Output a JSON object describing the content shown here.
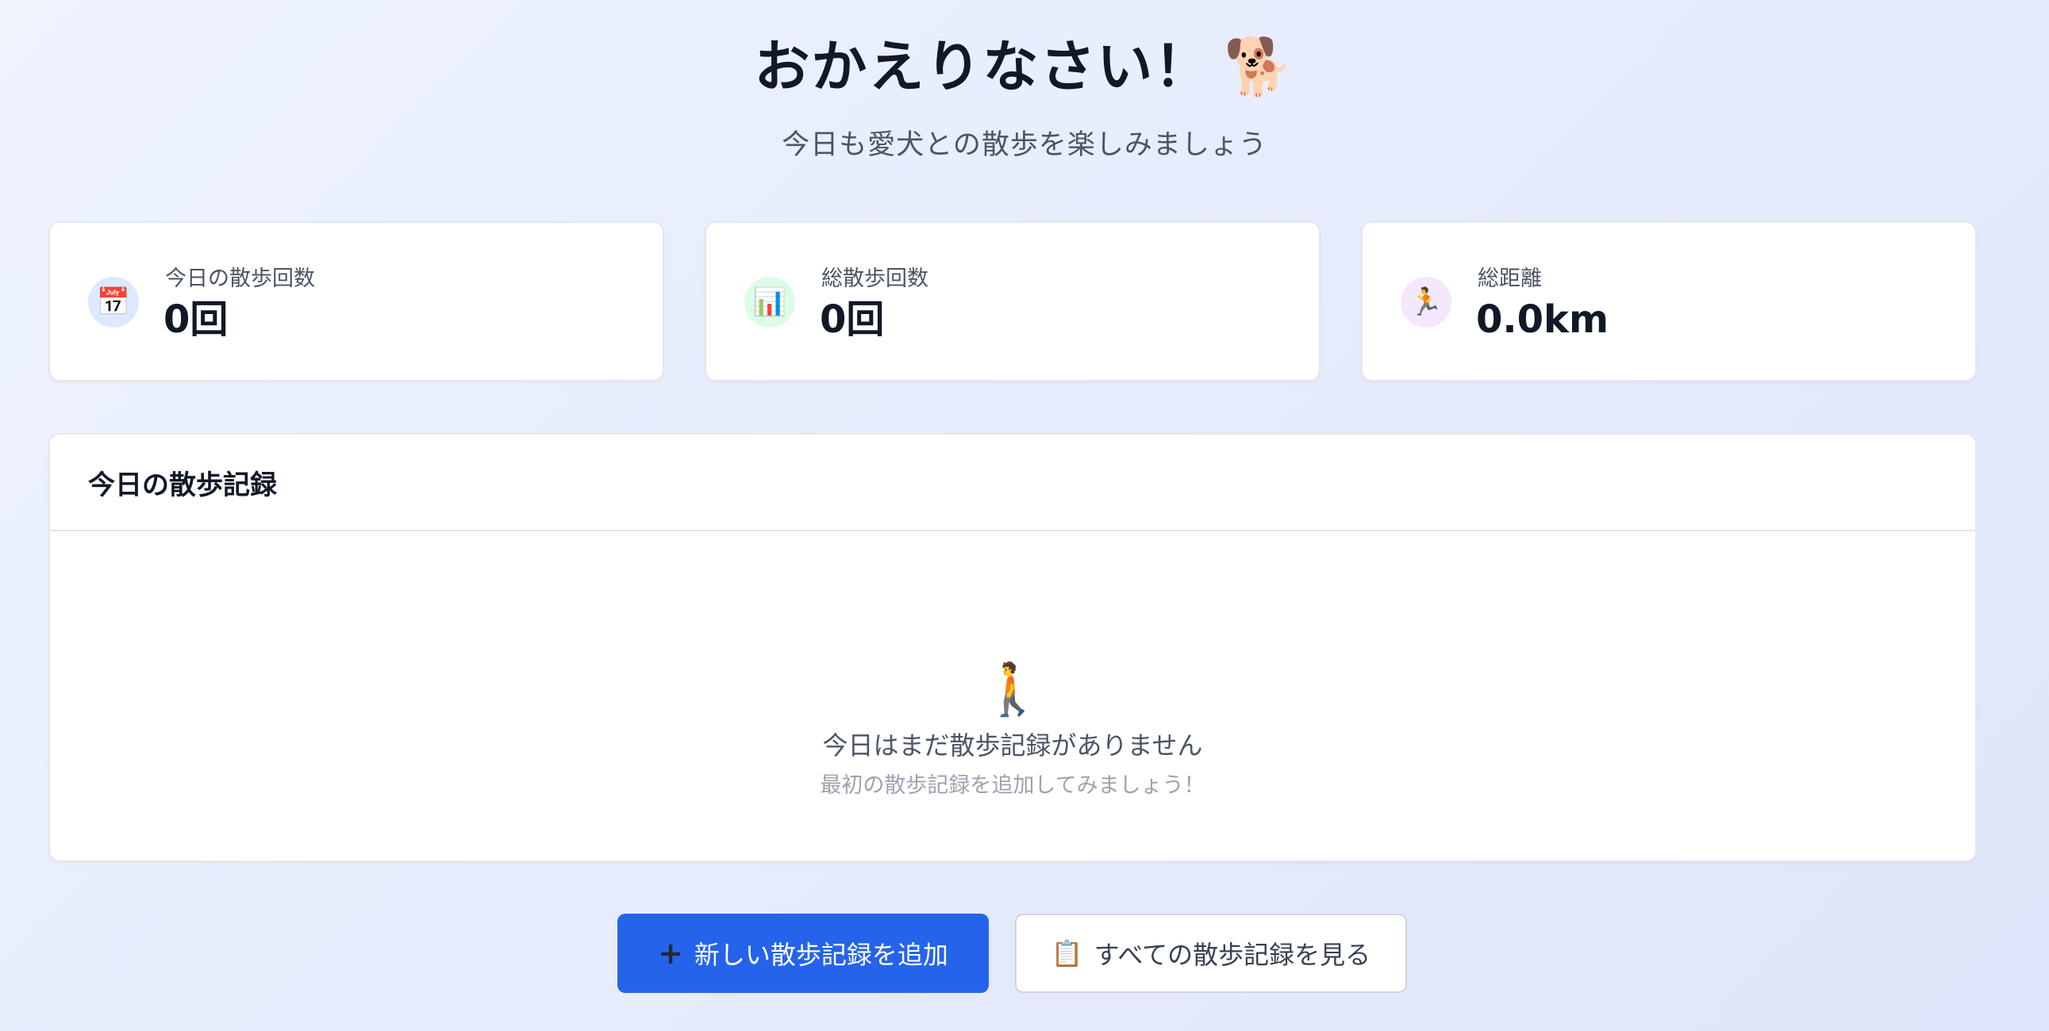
{
  "header": {
    "title": "おかえりなさい！",
    "title_emoji": "🐕",
    "subtitle": "今日も愛犬との散歩を楽しみましょう"
  },
  "stats": [
    {
      "icon": "📅",
      "icon_name": "calendar-icon",
      "label": "今日の散歩回数",
      "value": "0回"
    },
    {
      "icon": "📊",
      "icon_name": "bar-chart-icon",
      "label": "総散歩回数",
      "value": "0回"
    },
    {
      "icon": "🏃",
      "icon_name": "runner-icon",
      "label": "総距離",
      "value": "0.0km"
    }
  ],
  "records": {
    "title": "今日の散歩記録",
    "empty_icon": "🚶",
    "empty_text": "今日はまだ散歩記録がありません",
    "empty_sub": "最初の散歩記録を追加してみましょう！"
  },
  "actions": {
    "add_icon": "+",
    "add_label": "新しい散歩記録を追加",
    "view_icon": "📋",
    "view_label": "すべての散歩記録を見る"
  },
  "colors": {
    "primary": "#2563eb",
    "text": "#111827",
    "muted": "#4b5563"
  }
}
